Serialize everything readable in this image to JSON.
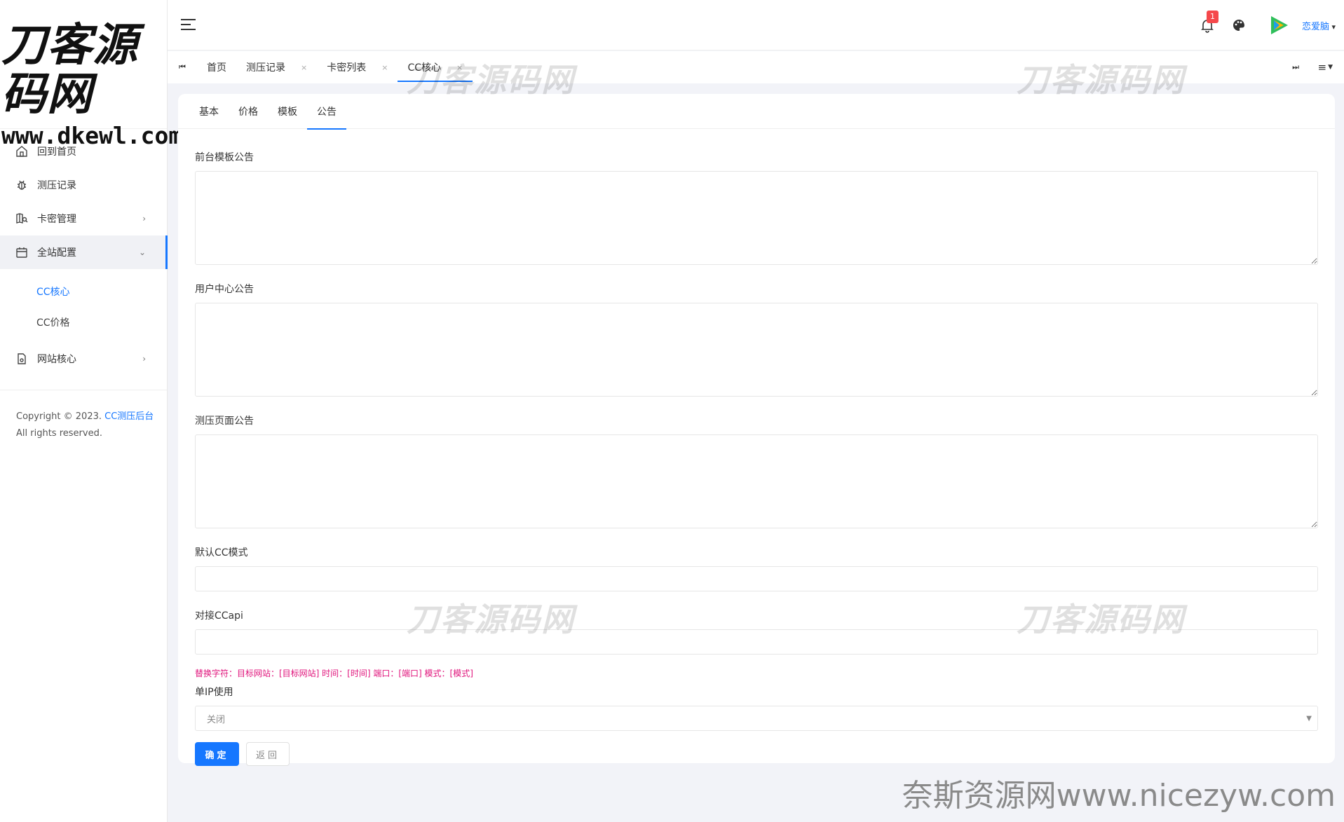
{
  "logo": {
    "line1": "刀客源码网",
    "line2": "www.dkewl.com"
  },
  "sidebar": {
    "items": [
      {
        "label": "回到首页",
        "icon": "home-icon"
      },
      {
        "label": "测压记录",
        "icon": "bug-icon"
      },
      {
        "label": "卡密管理",
        "icon": "map-search-icon",
        "arrow": "›"
      },
      {
        "label": "全站配置",
        "icon": "calendar-icon",
        "arrow": "⌄"
      },
      {
        "label": "网站核心",
        "icon": "file-icon",
        "arrow": "›"
      }
    ],
    "subitems": [
      {
        "label": "CC核心"
      },
      {
        "label": "CC价格"
      }
    ],
    "copyright_prefix": "Copyright © 2023.",
    "copyright_link": "CC测压后台",
    "copyright_suffix": "All rights reserved."
  },
  "header": {
    "notification_count": "1",
    "username": "恋爱脑"
  },
  "tabstrip": {
    "first_glyph": "⏮",
    "last_glyph": "⏭",
    "menu_glyph": "≡",
    "tabs": [
      {
        "label": "首页",
        "close": ""
      },
      {
        "label": "测压记录",
        "close": "×"
      },
      {
        "label": "卡密列表",
        "close": "×"
      },
      {
        "label": "CC核心",
        "close": "×"
      }
    ]
  },
  "card": {
    "tabs": [
      "基本",
      "价格",
      "模板",
      "公告"
    ],
    "fields": {
      "front_notice_label": "前台模板公告",
      "user_center_notice_label": "用户中心公告",
      "stress_page_notice_label": "测压页面公告",
      "default_mode_label": "默认CC模式",
      "api_label": "对接CCapi",
      "hint": "替换字符：目标网站：[目标网站] 时间：[时间] 端口：[端口] 模式：[模式]",
      "single_ip_label": "单IP使用",
      "single_ip_value": "关闭"
    },
    "buttons": {
      "confirm": "确定",
      "back": "返回"
    }
  },
  "watermarks": {
    "site": "刀客源码网",
    "bottom": "奈斯资源网www.nicezyw.com"
  },
  "colors": {
    "accent": "#1677ff",
    "hint": "#e0137b",
    "badge": "#f5484b"
  }
}
